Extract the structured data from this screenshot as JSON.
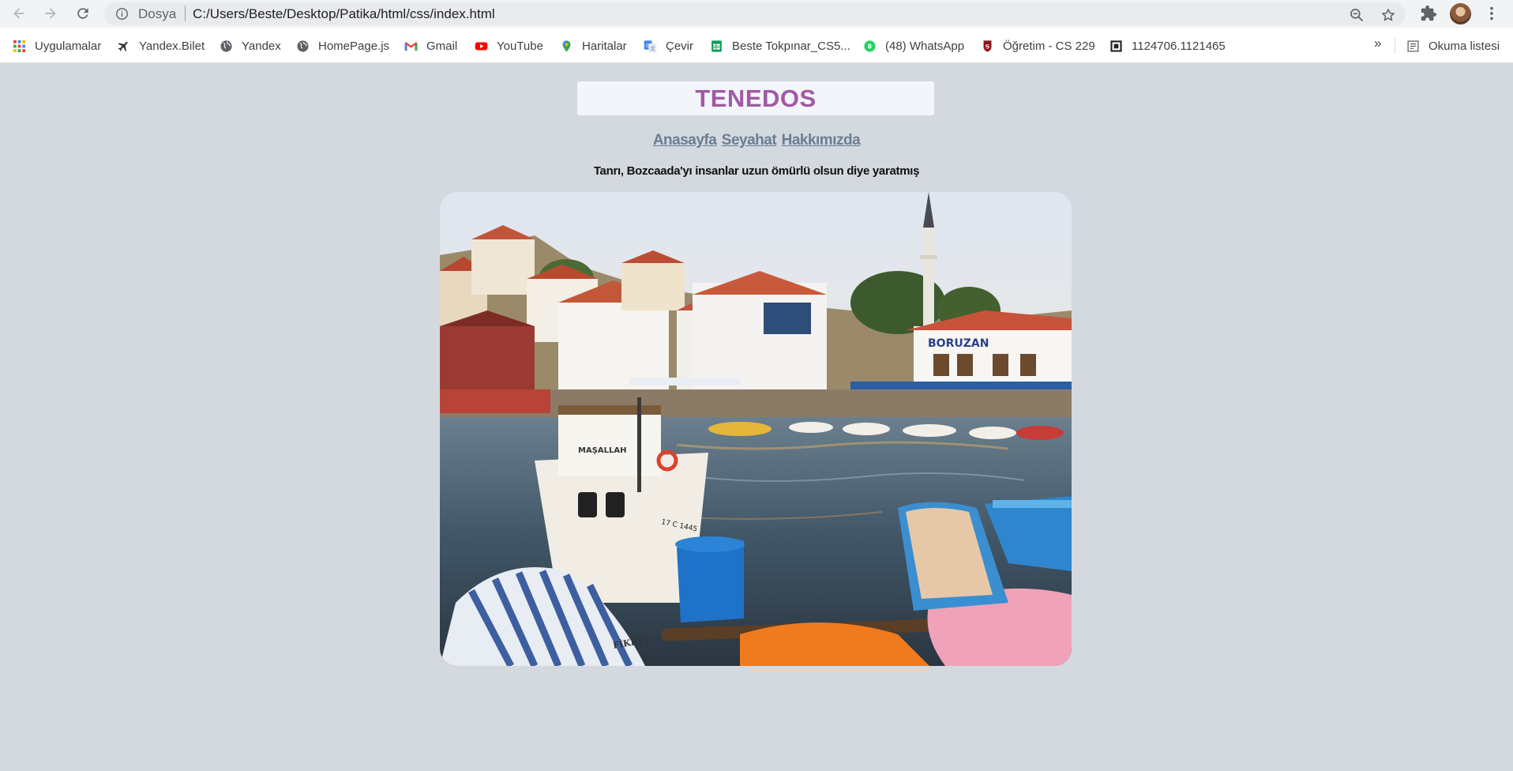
{
  "browser": {
    "url_scheme": "Dosya",
    "url": "C:/Users/Beste/Desktop/Patika/html/css/index.html",
    "bookmarks": [
      {
        "label": "Uygulamalar",
        "icon": "apps-grid-icon"
      },
      {
        "label": "Yandex.Bilet",
        "icon": "plane-icon"
      },
      {
        "label": "Yandex",
        "icon": "globe-icon"
      },
      {
        "label": "HomePage.js",
        "icon": "globe-icon"
      },
      {
        "label": "Gmail",
        "icon": "gmail-icon"
      },
      {
        "label": "YouTube",
        "icon": "youtube-icon"
      },
      {
        "label": "Haritalar",
        "icon": "maps-pin-icon"
      },
      {
        "label": "Çevir",
        "icon": "translate-icon"
      },
      {
        "label": "Beste Tokpınar_CS5...",
        "icon": "sheets-icon"
      },
      {
        "label": "(48) WhatsApp",
        "icon": "whatsapp-icon"
      },
      {
        "label": "Öğretim - CS 229",
        "icon": "stanford-icon"
      },
      {
        "label": "1124706.1121465",
        "icon": "file-icon"
      }
    ],
    "more": "»",
    "reading_list": "Okuma listesi"
  },
  "page": {
    "title": "TENEDOS",
    "menu": [
      "Anasayfa",
      "Seyahat",
      "Hakkımızda"
    ],
    "quote": "Tanrı, Bozcaada'yı insanlar uzun ömürlü olsun diye yaratmış",
    "photo_signs": {
      "boat_name": "MAŞALLAH",
      "boat_reg": "17 C 1445",
      "restaurant": "BORUZAN",
      "boat_name_2": "FİKRET"
    }
  },
  "colors": {
    "page_bg": "#d3d9de",
    "title": "#a05aa5",
    "menu_link": "#6a7d93"
  }
}
